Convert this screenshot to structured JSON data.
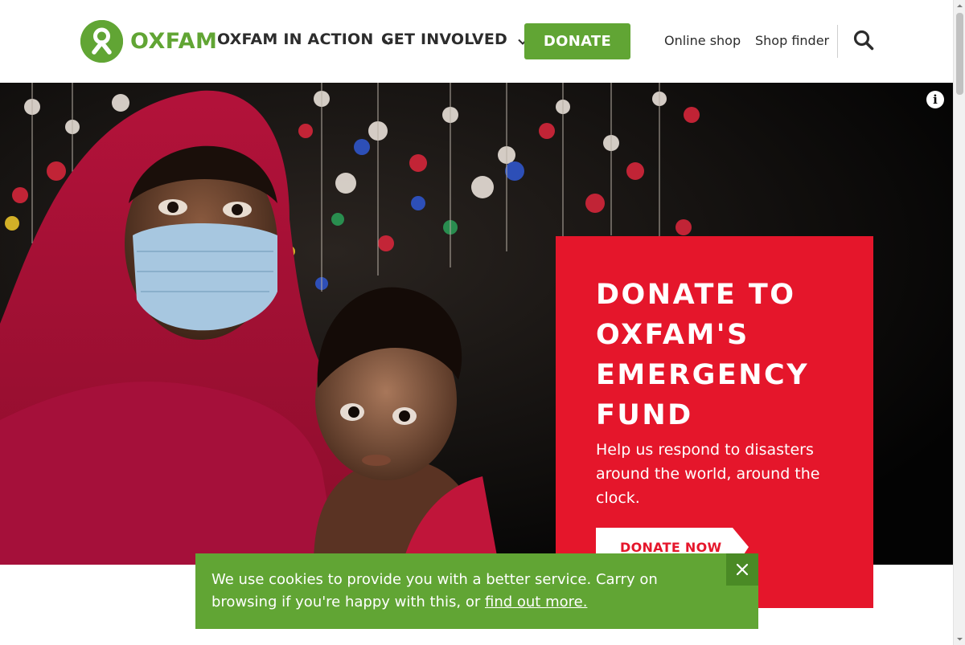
{
  "brand": {
    "name": "OXFAM",
    "color": "#61a534",
    "logo_icon": "oxfam-logo-icon"
  },
  "nav": {
    "items": [
      {
        "label": "OXFAM IN ACTION",
        "icon": "chevron-down-icon"
      },
      {
        "label": "GET INVOLVED",
        "icon": "chevron-down-icon"
      }
    ],
    "donate_label": "DONATE",
    "utility_links": [
      "Online shop",
      "Shop finder"
    ],
    "search_icon": "search-icon"
  },
  "hero": {
    "info_icon": "info-icon",
    "info_label": "i",
    "callout": {
      "title": "DONATE TO OXFAM'S EMERGENCY FUND",
      "text": "Help us respond to disasters around the world, around the clock.",
      "cta_label": "DONATE NOW",
      "color": "#e5162b"
    }
  },
  "cookie_banner": {
    "text": "We use cookies to provide you with a better service. Carry on browsing if you're happy with this, or ",
    "link_text": "find out more.",
    "close_icon": "close-icon",
    "color": "#61a534"
  }
}
